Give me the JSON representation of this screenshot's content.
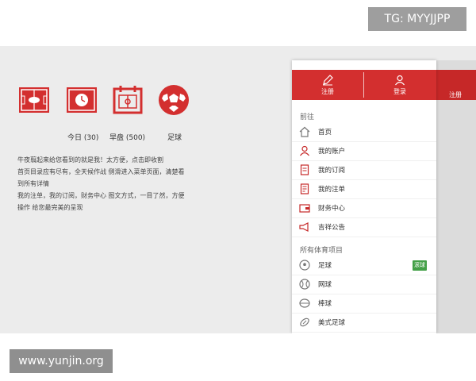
{
  "badges": {
    "tg": "TG: MYYJJPP",
    "url": "www.yunjin.org"
  },
  "features": [
    {
      "icon": "field-icon",
      "label": ""
    },
    {
      "icon": "clock-field-icon",
      "label": "今日 (30)"
    },
    {
      "icon": "calendar-field-icon",
      "label": "早盘 (500)"
    },
    {
      "icon": "soccer-ball-icon",
      "label": "足球"
    }
  ],
  "description": [
    "牛夜翦起来给您看到的就是我！太方便，点击即收割",
    "首页目录应有尽有，全天候作战 侧滑进入菜单页面，清楚看",
    "到所有详情",
    "我的注单，我的订阅，财务中心 图文方式，一目了然，方便",
    "操作 给您最完美的呈现"
  ],
  "drawer": {
    "header": {
      "register": "注册",
      "login": "登录"
    },
    "section1": "前往",
    "menu": [
      {
        "icon": "home-icon",
        "label": "首页"
      },
      {
        "icon": "user-icon",
        "label": "我的账户"
      },
      {
        "icon": "document-icon",
        "label": "我的订阅"
      },
      {
        "icon": "note-icon",
        "label": "我的注单"
      },
      {
        "icon": "wallet-icon",
        "label": "财务中心"
      },
      {
        "icon": "megaphone-icon",
        "label": "吉祥公告"
      }
    ],
    "section2": "所有体育项目",
    "sports": [
      {
        "icon": "soccer-icon",
        "label": "足球",
        "tag": "滚球"
      },
      {
        "icon": "tennis-icon",
        "label": "网球"
      },
      {
        "icon": "baseball-icon",
        "label": "棒球"
      },
      {
        "icon": "football-icon",
        "label": "美式足球"
      }
    ]
  },
  "background_strip": {
    "header_text": "注册"
  },
  "colors": {
    "brand_red": "#d32f2f",
    "tag_green": "#43a047",
    "content_bg": "#ececec"
  }
}
